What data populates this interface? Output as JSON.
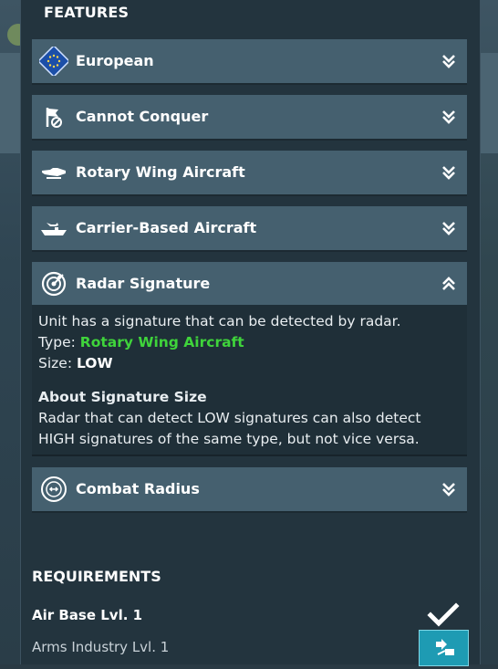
{
  "features": {
    "title": "FEATURES",
    "items": [
      {
        "label": "European",
        "icon": "eu-flag-icon",
        "state": "collapsed"
      },
      {
        "label": "Cannot Conquer",
        "icon": "no-flag-icon",
        "state": "collapsed"
      },
      {
        "label": "Rotary Wing Aircraft",
        "icon": "helicopter-icon",
        "state": "collapsed"
      },
      {
        "label": "Carrier-Based Aircraft",
        "icon": "carrier-icon",
        "state": "collapsed"
      },
      {
        "label": "Radar Signature",
        "icon": "radar-icon",
        "state": "expanded"
      },
      {
        "label": "Combat Radius",
        "icon": "radius-icon",
        "state": "collapsed"
      }
    ]
  },
  "radar": {
    "description": "Unit has a signature that can be detected by radar.",
    "type_label": "Type: ",
    "type_value": "Rotary Wing Aircraft",
    "size_label": "Size: ",
    "size_value": "LOW",
    "about_title": "About Signature Size",
    "about_line1": "Radar that can detect LOW signatures can also detect",
    "about_line2": "HIGH signatures of the same type, but not vice versa."
  },
  "requirements": {
    "title": "REQUIREMENTS",
    "items": [
      {
        "label": "Air Base Lvl. 1",
        "status": "met"
      },
      {
        "label": "Arms Industry Lvl. 1",
        "status": "unmet"
      }
    ]
  },
  "colors": {
    "accent_green": "#3fd43b",
    "feature_bar": "#45606f",
    "panel": "#23343e",
    "button": "#1e9bb3"
  }
}
